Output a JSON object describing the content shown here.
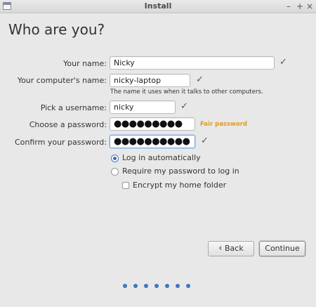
{
  "window": {
    "title": "Install"
  },
  "page": {
    "heading": "Who are you?"
  },
  "form": {
    "name_label": "Your name:",
    "name_value": "Nicky",
    "computer_label": "Your computer's name:",
    "computer_value": "nicky-laptop",
    "computer_hint": "The name it uses when it talks to other computers.",
    "username_label": "Pick a username:",
    "username_value": "nicky",
    "password_label": "Choose a password:",
    "password_value": "●●●●●●●●●",
    "password_strength": "Fair password",
    "confirm_label": "Confirm your password:",
    "confirm_value": "●●●●●●●●●●"
  },
  "options": {
    "auto_login": "Log in automatically",
    "require_password": "Require my password to log in",
    "encrypt_home": "Encrypt my home folder"
  },
  "buttons": {
    "back": "Back",
    "continue": "Continue"
  },
  "colors": {
    "accent": "#3f77c4",
    "strength_fair": "#e39a1a"
  }
}
